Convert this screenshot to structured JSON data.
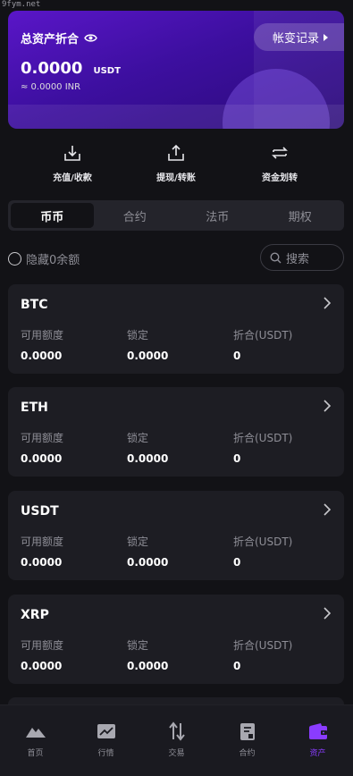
{
  "watermark": "9fym.net",
  "asset_card": {
    "title": "总资产折合",
    "amount": "0.0000",
    "unit": "USDT",
    "inr": "≈ 0.0000 INR",
    "record_button": "帐变记录"
  },
  "actions": [
    {
      "label": "充值/收款",
      "icon": "download-tray-icon"
    },
    {
      "label": "提现/转账",
      "icon": "upload-tray-icon"
    },
    {
      "label": "资金划转",
      "icon": "transfer-arrows-icon"
    }
  ],
  "tabs": [
    "币币",
    "合约",
    "法币",
    "期权"
  ],
  "active_tab": "币币",
  "filter": {
    "hide_zero_label": "隐藏0余额",
    "search_placeholder": "搜索"
  },
  "columns": [
    "可用额度",
    "锁定",
    "折合(USDT)"
  ],
  "coins": [
    {
      "name": "BTC",
      "available": "0.0000",
      "locked": "0.0000",
      "usdt": "0"
    },
    {
      "name": "ETH",
      "available": "0.0000",
      "locked": "0.0000",
      "usdt": "0"
    },
    {
      "name": "USDT",
      "available": "0.0000",
      "locked": "0.0000",
      "usdt": "0"
    },
    {
      "name": "XRP",
      "available": "0.0000",
      "locked": "0.0000",
      "usdt": "0"
    }
  ],
  "nav": [
    {
      "label": "首页",
      "icon": "mountain-icon"
    },
    {
      "label": "行情",
      "icon": "chart-icon"
    },
    {
      "label": "交易",
      "icon": "trade-arrows-icon"
    },
    {
      "label": "合约",
      "icon": "contract-icon"
    },
    {
      "label": "资产",
      "icon": "wallet-icon",
      "active": true
    }
  ],
  "colors": {
    "accent": "#8a3cff",
    "card": "#1d1d23",
    "background": "#121216"
  }
}
